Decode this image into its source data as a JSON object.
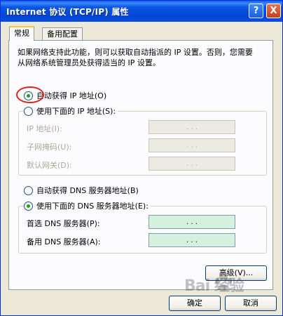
{
  "window": {
    "title": "Internet 协议 (TCP/IP) 属性",
    "help_button": "?",
    "close_button": "X"
  },
  "tabs": [
    {
      "label": "常规",
      "active": true
    },
    {
      "label": "备用配置",
      "active": false
    }
  ],
  "description": "如果网络支持此功能，则可以获取自动指派的 IP 设置。否则，您需要从网络系统管理员处获得适当的 IP 设置。",
  "ip": {
    "auto_label": "自动获得 IP 地址(O)",
    "manual_label": "使用下面的 IP 地址(S):",
    "selected": "auto",
    "fields": [
      {
        "label": "IP 地址(I):",
        "value": ". . ."
      },
      {
        "label": "子网掩码(U):",
        "value": ". . ."
      },
      {
        "label": "默认网关(D):",
        "value": ". . ."
      }
    ]
  },
  "dns": {
    "auto_label": "自动获得 DNS 服务器地址(B)",
    "manual_label": "使用下面的 DNS 服务器地址(E):",
    "selected": "manual",
    "fields": [
      {
        "label": "首选 DNS 服务器(P):",
        "value": ". . ."
      },
      {
        "label": "备用 DNS 服务器(A):",
        "value": ". . ."
      }
    ]
  },
  "buttons": {
    "advanced": "高级(V)...",
    "ok": "确定",
    "cancel": "取消"
  },
  "watermark": "Bai 经验",
  "colors": {
    "titlebar": "#0a4fe0",
    "highlight_circle": "#e0201e",
    "radio_dot": "#21a121"
  }
}
